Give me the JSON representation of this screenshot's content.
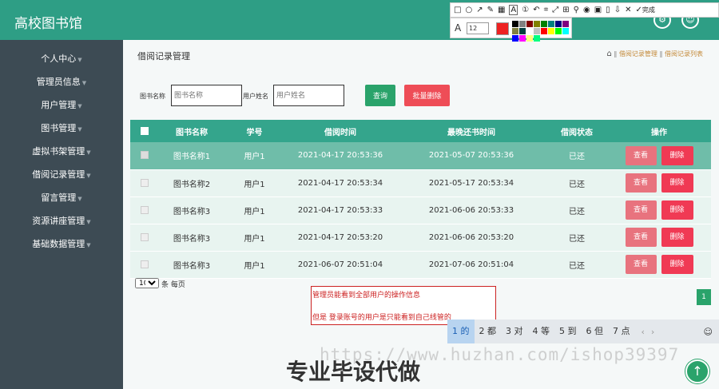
{
  "app": {
    "title": "高校图书馆"
  },
  "sidebar": {
    "items": [
      {
        "label": "个人中心",
        "has_caret": true
      },
      {
        "label": "管理员信息",
        "has_caret": true
      },
      {
        "label": "用户管理",
        "has_caret": true
      },
      {
        "label": "图书管理",
        "has_caret": true
      },
      {
        "label": "虚拟书架管理",
        "has_caret": true
      },
      {
        "label": "借阅记录管理",
        "has_caret": true
      },
      {
        "label": "留言管理",
        "has_caret": true
      },
      {
        "label": "资源讲座管理",
        "has_caret": true
      },
      {
        "label": "基础数据管理",
        "has_caret": true
      }
    ]
  },
  "page": {
    "title": "借阅记录管理",
    "breadcrumb": [
      "借阅记录管理",
      "借阅记录列表"
    ]
  },
  "search": {
    "book_label": "图书名称",
    "book_placeholder": "图书名称",
    "user_label": "用户姓名",
    "user_placeholder": "用户姓名",
    "query_label": "查询",
    "batch_delete_label": "批量删除"
  },
  "table": {
    "headers": [
      "图书名称",
      "学号",
      "借阅时间",
      "最晚还书时间",
      "借阅状态",
      "操作"
    ],
    "view_label": "查看",
    "delete_label": "删除",
    "rows": [
      {
        "book": "图书名称1",
        "user": "用户1",
        "borrow_time": "2021-04-17 20:53:36",
        "due_time": "2021-05-07 20:53:36",
        "status": "已还"
      },
      {
        "book": "图书名称2",
        "user": "用户1",
        "borrow_time": "2021-04-17 20:53:34",
        "due_time": "2021-05-17 20:53:34",
        "status": "已还"
      },
      {
        "book": "图书名称3",
        "user": "用户1",
        "borrow_time": "2021-04-17 20:53:33",
        "due_time": "2021-06-06 20:53:33",
        "status": "已还"
      },
      {
        "book": "图书名称3",
        "user": "用户1",
        "borrow_time": "2021-04-17 20:53:20",
        "due_time": "2021-06-06 20:53:20",
        "status": "已还"
      },
      {
        "book": "图书名称3",
        "user": "用户1",
        "borrow_time": "2021-06-07 20:51:04",
        "due_time": "2021-07-06 20:51:04",
        "status": "已还"
      }
    ]
  },
  "pager": {
    "page_size": "10",
    "per_page_label": "条 每页",
    "current_page": "1"
  },
  "note": {
    "line1": "管理员能看到全部用户的操作信息",
    "line2": "但是 登录账号的用户是只能看到自己线管的"
  },
  "ime": {
    "candidates": [
      "1 的",
      "2 都",
      "3 对",
      "4 等",
      "5 到",
      "6 但",
      "7 点"
    ]
  },
  "overlay": {
    "watermark": "https://www.huzhan.com/ishop39397",
    "big_text": "专业毕设代做"
  },
  "snip_tool": {
    "done_label": "完成",
    "font_size": "12",
    "current_color": "#ee2222",
    "colors": [
      "#000000",
      "#808080",
      "#800000",
      "#808000",
      "#008000",
      "#008080",
      "#000080",
      "#800080",
      "#808040",
      "#004040",
      "#ffffff",
      "#c0c0c0",
      "#ff0000",
      "#ffff00",
      "#00ff00",
      "#00ffff",
      "#0000ff",
      "#ff00ff",
      "#ffff80",
      "#00ff80"
    ]
  }
}
